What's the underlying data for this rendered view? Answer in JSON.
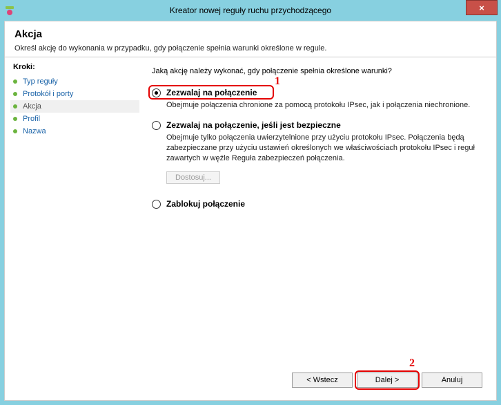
{
  "window": {
    "title": "Kreator nowej reguły ruchu przychodzącego",
    "close": "×"
  },
  "header": {
    "title": "Akcja",
    "desc": "Określ akcję do wykonania w przypadku, gdy połączenie spełnia warunki określone w regule."
  },
  "sidebar": {
    "heading": "Kroki:",
    "steps": [
      {
        "label": "Typ reguły"
      },
      {
        "label": "Protokół i porty"
      },
      {
        "label": "Akcja"
      },
      {
        "label": "Profil"
      },
      {
        "label": "Nazwa"
      }
    ]
  },
  "content": {
    "question": "Jaką akcję należy wykonać, gdy połączenie spełnia określone warunki?",
    "options": {
      "allow": {
        "label": "Zezwalaj na połączenie",
        "desc": "Obejmuje połączenia chronione za pomocą protokołu IPsec, jak i połączenia niechronione."
      },
      "allow_secure": {
        "label": "Zezwalaj na połączenie, jeśli jest bezpieczne",
        "desc": "Obejmuje tylko połączenia uwierzytelnione przy użyciu protokołu IPsec. Połączenia będą zabezpieczane przy użyciu ustawień określonych we właściwościach protokołu IPsec i reguł zawartych w węźle Reguła zabezpieczeń połączenia.",
        "customize": "Dostosuj..."
      },
      "block": {
        "label": "Zablokuj połączenie"
      }
    }
  },
  "footer": {
    "back": "< Wstecz",
    "next": "Dalej >",
    "cancel": "Anuluj"
  },
  "annotations": {
    "one": "1",
    "two": "2"
  }
}
